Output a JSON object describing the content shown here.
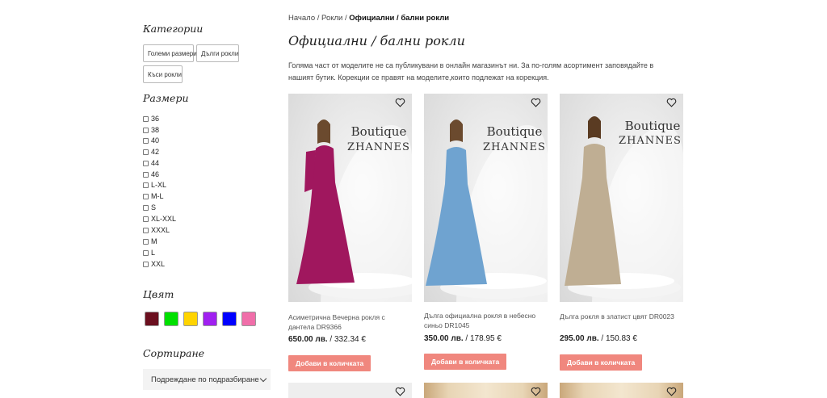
{
  "sidebar": {
    "categories_heading": "Категории",
    "categories": [
      "Големи размери",
      "Дълги рокли",
      "Къси рокли"
    ],
    "sizes_heading": "Размери",
    "sizes": [
      "36",
      "38",
      "40",
      "42",
      "44",
      "46",
      "L-XL",
      "M-L",
      "S",
      "XL-XXL",
      "XXXL",
      "M",
      "L",
      "XXL"
    ],
    "color_heading": "Цвят",
    "colors": [
      "#6b0f1f",
      "#00e000",
      "#ffd400",
      "#a020f0",
      "#0000ff",
      "#f06ea9"
    ],
    "sort_heading": "Сортиране",
    "sort_value": "Подреждане по подразбиране"
  },
  "breadcrumb": {
    "home": "Начало",
    "sep1": " / ",
    "dresses": "Рокли",
    "sep2": " / ",
    "current": "Официални / бални рокли"
  },
  "page": {
    "title": "Официални / бални рокли",
    "intro": "Голяма част от моделите не са публикувани в онлайн магазинът ни. За по-голям асортимент заповядайте в нашият бутик. Корекции се правят на моделите,които подлежат на корекция."
  },
  "products": [
    {
      "name": "Асиметрична Вечерна рокля с дантела DR9366",
      "price_bgn": "650.00 лв.",
      "price_eur": " / 332.34 €",
      "button": "Добави в количката",
      "brand_line1": "Boutique",
      "brand_line2": "ZHANNES",
      "dress_color": "#a0175e"
    },
    {
      "name": "Дълга официална рокля в небесно синьо DR1045",
      "price_bgn": "350.00 лв.",
      "price_eur": " / 178.95 €",
      "button": "Добави в количката",
      "brand_line1": "Boutique",
      "brand_line2": "ZHANNES",
      "dress_color": "#6fa3d0"
    },
    {
      "name": "Дълга рокля в златист цвят DR0023",
      "price_bgn": "295.00 лв.",
      "price_eur": " / 150.83 €",
      "button": "Добави в количката",
      "brand_line1": "Boutique",
      "brand_line2": "ZHANNES",
      "dress_color": "#bfae93"
    }
  ]
}
